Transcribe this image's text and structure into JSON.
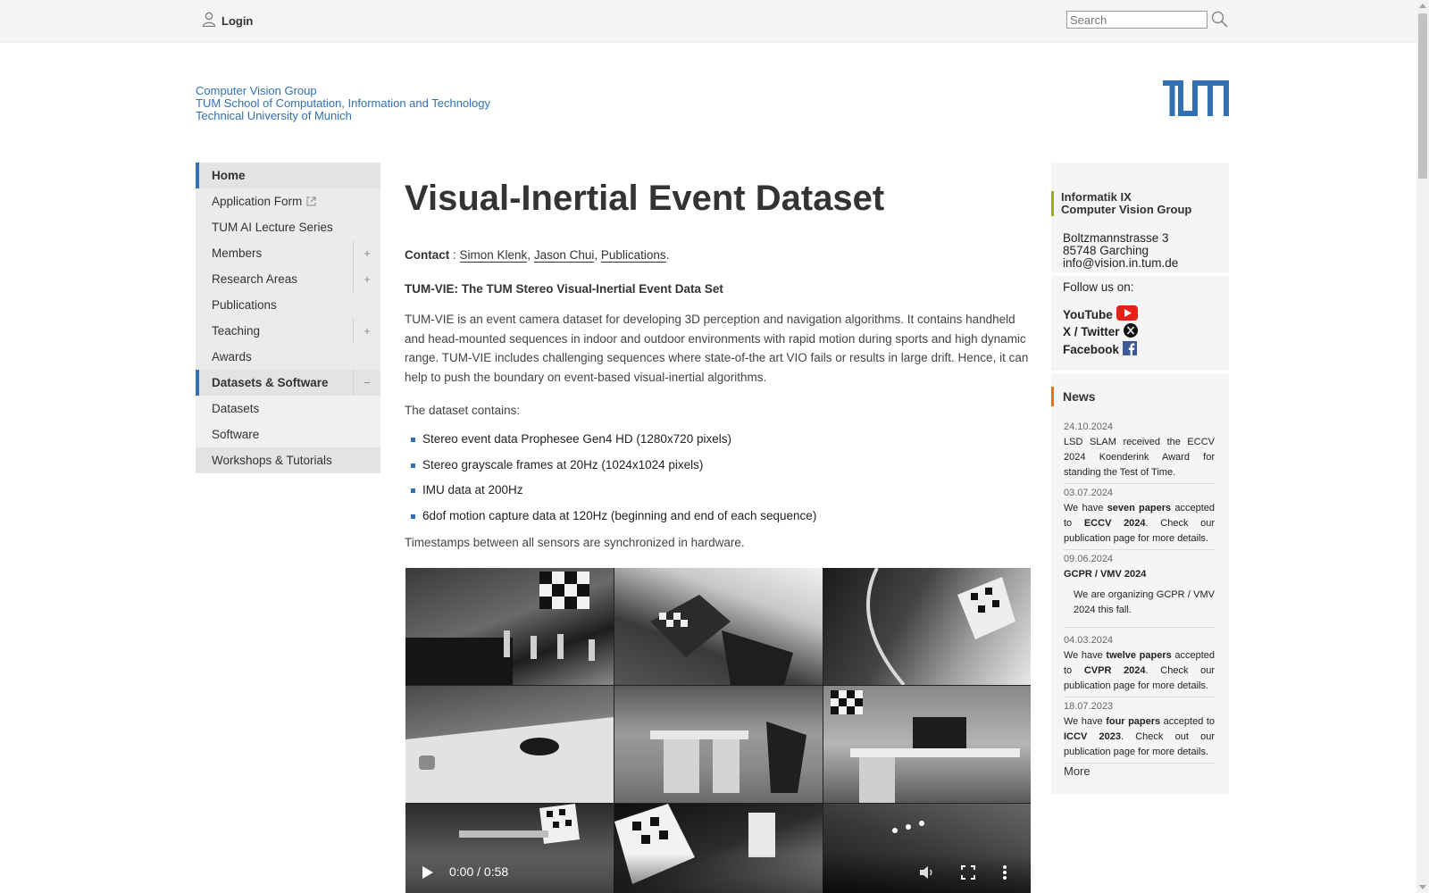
{
  "topbar": {
    "login_label": "Login",
    "search_placeholder": "Search"
  },
  "header": {
    "affiliation": [
      "Computer Vision Group",
      "TUM School of Computation, Information and Technology",
      "Technical University of Munich"
    ]
  },
  "nav": {
    "items": [
      {
        "label": "Home"
      },
      {
        "label": "Application Form"
      },
      {
        "label": "TUM AI Lecture Series"
      },
      {
        "label": "Members",
        "toggle": "+"
      },
      {
        "label": "Research Areas",
        "toggle": "+"
      },
      {
        "label": "Publications"
      },
      {
        "label": "Teaching",
        "toggle": "+"
      },
      {
        "label": "Awards"
      },
      {
        "label": "Datasets & Software",
        "toggle": "−"
      },
      {
        "label": "Datasets"
      },
      {
        "label": "Software"
      },
      {
        "label": "Workshops & Tutorials"
      }
    ]
  },
  "main": {
    "title": "Visual-Inertial Event Dataset",
    "contact_label": "Contact",
    "contact_sep": " : ",
    "contact_links": [
      "Simon Klenk",
      "Jason Chui",
      "Publications"
    ],
    "subtitle": "TUM-VIE: The TUM Stereo Visual-Inertial Event Data Set",
    "intro": "TUM-VIE is an event camera dataset for developing 3D perception and navigation algorithms. It contains handheld and head-mounted sequences in indoor and outdoor environments with rapid motion during sports and high dynamic range. TUM-VIE includes challenging sequences where state-of-the art VIO fails or results in large drift. Hence, it can help to push the boundary on event-based visual-inertial algorithms.",
    "contains_label": "The dataset contains:",
    "features": [
      "Stereo event data Prophesee Gen4 HD (1280x720 pixels)",
      "Stereo grayscale frames at 20Hz (1024x1024 pixels)",
      "IMU data at 200Hz",
      "6dof motion capture data at 120Hz (beginning and end of each sequence)"
    ],
    "timestamps": "Timestamps between all sensors are synchronized in hardware.",
    "video": {
      "time": "0:00 / 0:58",
      "progress": 0
    }
  },
  "sidebar": {
    "org": [
      "Informatik IX",
      "Computer Vision Group"
    ],
    "address": [
      "Boltzmannstrasse 3",
      "85748 Garching",
      "info@vision.in.tum.de"
    ],
    "follow_label": "Follow us on:",
    "social": [
      "YouTube",
      "X / Twitter",
      "Facebook"
    ],
    "news_title": "News",
    "news": [
      {
        "date": "24.10.2024",
        "text": "LSD SLAM received the ECCV 2024 Koenderink Award for standing the Test of Time."
      },
      {
        "date": "03.07.2024",
        "pre": "We have ",
        "link": "seven papers",
        "mid": " accepted to ",
        "venue": "ECCV 2024",
        "post": ". Check our ",
        "link2": "publication page",
        "end": " for more details."
      },
      {
        "date": "09.06.2024",
        "heading": "GCPR / VMV 2024",
        "pre": "We are organizing ",
        "link": "GCPR / VMV 2024",
        "end": " this fall."
      },
      {
        "date": "04.03.2024",
        "pre": "We have ",
        "link": "twelve papers",
        "mid": " accepted to ",
        "venue": "CVPR 2024",
        "post": ". Check our ",
        "link2": "publication page",
        "end": " for more details."
      },
      {
        "date": "18.07.2023",
        "pre": "We have ",
        "bold": "four papers",
        "mid": " accepted to ",
        "venue": "ICCV 2023",
        "post": ". Check out our ",
        "link2": "publication page",
        "end": " for more details."
      }
    ],
    "more_label": "More"
  },
  "colors": {
    "tum_blue": "#3070b3",
    "org_accent": "#a2ad00",
    "news_accent": "#e37222"
  }
}
